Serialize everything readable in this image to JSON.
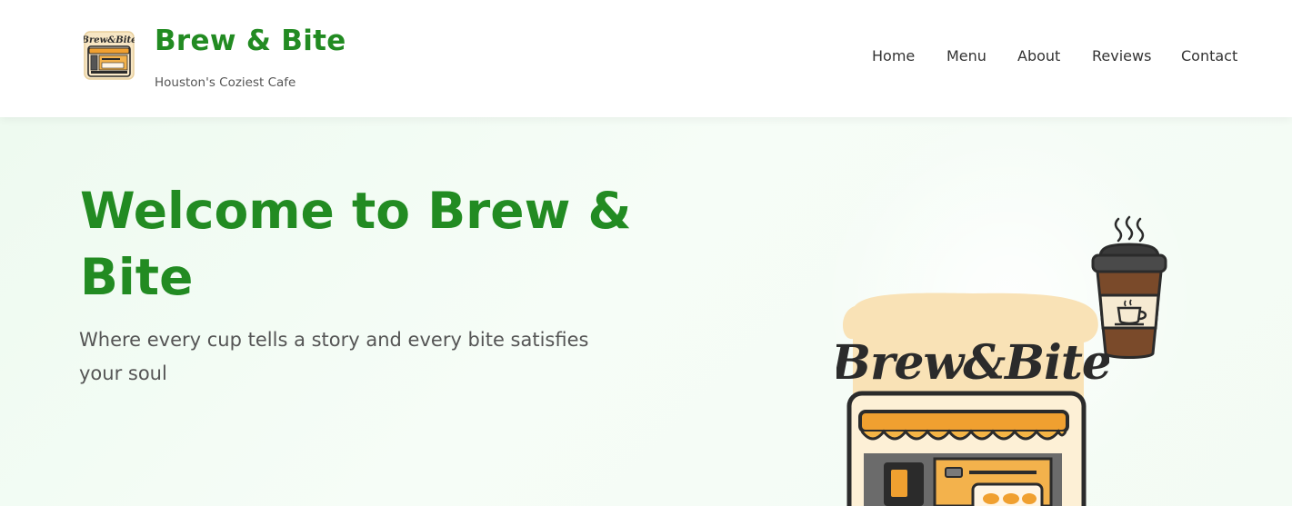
{
  "header": {
    "logo_alt_text": "Brew&Bite",
    "brand_name": "Brew & Bite",
    "tagline": "Houston's Coziest Cafe",
    "nav": [
      {
        "label": "Home"
      },
      {
        "label": "Menu"
      },
      {
        "label": "About"
      },
      {
        "label": "Reviews"
      },
      {
        "label": "Contact"
      }
    ]
  },
  "hero": {
    "title": "Welcome to Brew & Bite",
    "subtitle": "Where every cup tells a story and every bite satisfies your soul",
    "illustration_text": "Brew&Bite"
  },
  "colors": {
    "brand_green": "#228b22",
    "awning_orange": "#f0a030",
    "cup_brown": "#7a4a2a",
    "outline_dark": "#2b2b2b",
    "hero_background": "#f2fbf3"
  },
  "icons": [
    "cafe-logo-icon",
    "coffee-cup-icon",
    "steam-icon",
    "storefront-icon"
  ]
}
